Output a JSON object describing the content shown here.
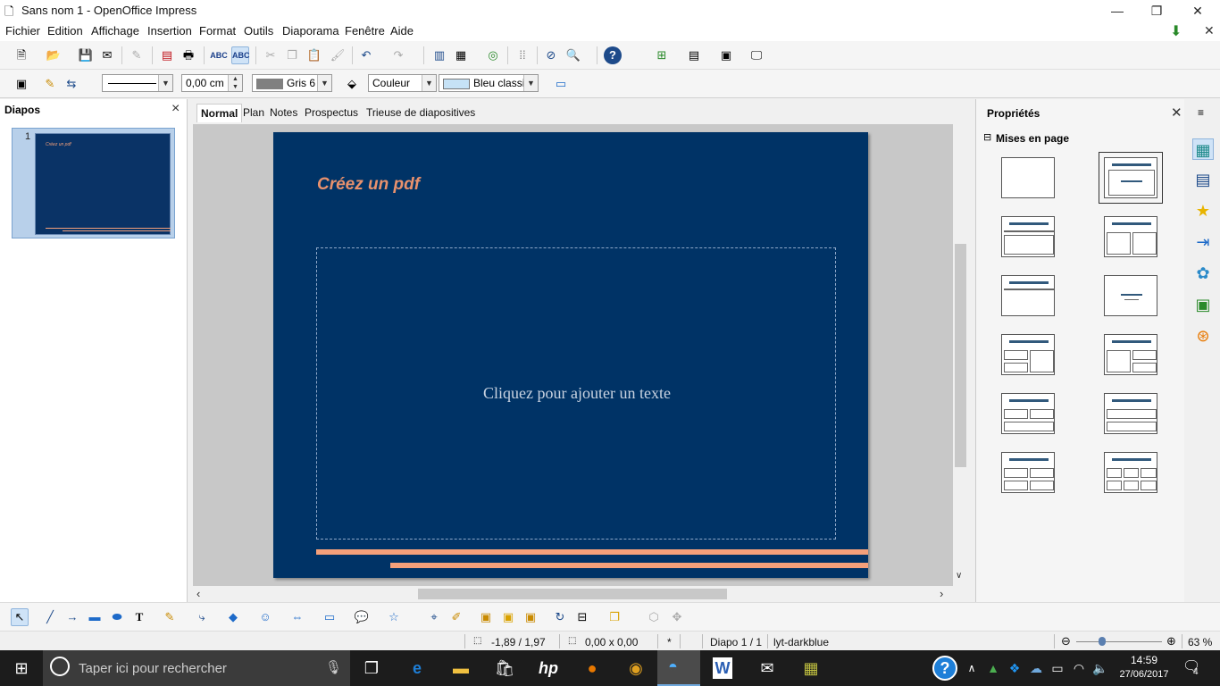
{
  "window": {
    "title": "Sans nom 1 - OpenOffice Impress",
    "controls": [
      "—",
      "❐",
      "✕"
    ]
  },
  "menu": [
    "Fichier",
    "Edition",
    "Affichage",
    "Insertion",
    "Format",
    "Outils",
    "Diaporama",
    "Fenêtre",
    "Aide"
  ],
  "toolbar2": {
    "line_width": "0,00 cm",
    "line_color": "Gris 6",
    "area_style": "Couleur",
    "area_color": "Bleu classique"
  },
  "slides_panel": {
    "title": "Diapos",
    "thumb_number": "1",
    "thumb_title": "Créez un pdf"
  },
  "tabs": [
    "Normal",
    "Plan",
    "Notes",
    "Prospectus",
    "Trieuse de diapositives"
  ],
  "slide": {
    "title": "Créez un pdf",
    "placeholder": "Cliquez pour ajouter un texte"
  },
  "properties": {
    "title": "Propriétés",
    "section": "Mises en page"
  },
  "status": {
    "position": "-1,89 / 1,97",
    "size": "0,00 x 0,00",
    "modified": "*",
    "slide": "Diapo 1 / 1",
    "layout": "lyt-darkblue",
    "zoom": "63 %"
  },
  "taskbar": {
    "search_placeholder": "Taper ici pour rechercher",
    "time": "14:59",
    "date": "27/06/2017",
    "notifications": "4"
  },
  "colors": {
    "slide_bg": "#003366",
    "accent": "#f4a07a",
    "title": "#e8916d"
  }
}
